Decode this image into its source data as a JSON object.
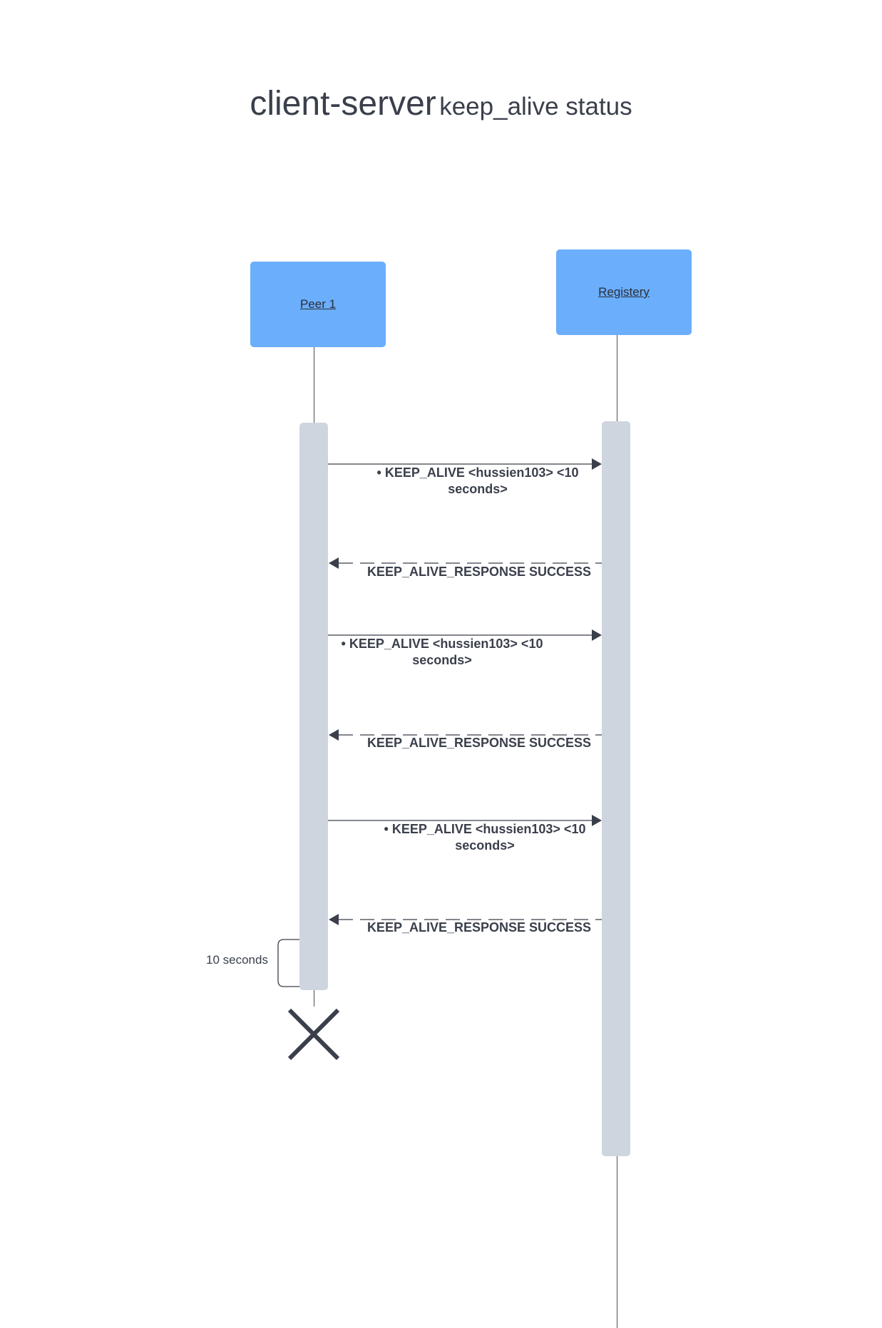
{
  "title": {
    "main": "client-server",
    "sub": "keep_alive status"
  },
  "actors": {
    "peer": "Peer 1",
    "registry": "Registery"
  },
  "messages": [
    {
      "type": "request",
      "line1": "• KEEP_ALIVE <hussien103> <10",
      "line2": "seconds>"
    },
    {
      "type": "response",
      "line1": "KEEP_ALIVE_RESPONSE SUCCESS"
    },
    {
      "type": "request",
      "line1": "• KEEP_ALIVE <hussien103> <10",
      "line2": "seconds>"
    },
    {
      "type": "response",
      "line1": "KEEP_ALIVE_RESPONSE SUCCESS"
    },
    {
      "type": "request",
      "line1": "• KEEP_ALIVE <hussien103> <10",
      "line2": "seconds>"
    },
    {
      "type": "response",
      "line1": "KEEP_ALIVE_RESPONSE SUCCESS"
    }
  ],
  "timeout_note": "10 seconds",
  "colors": {
    "actor_fill": "#6aaefc",
    "activation_fill": "#ced5de",
    "ink": "#3a3f4b"
  }
}
